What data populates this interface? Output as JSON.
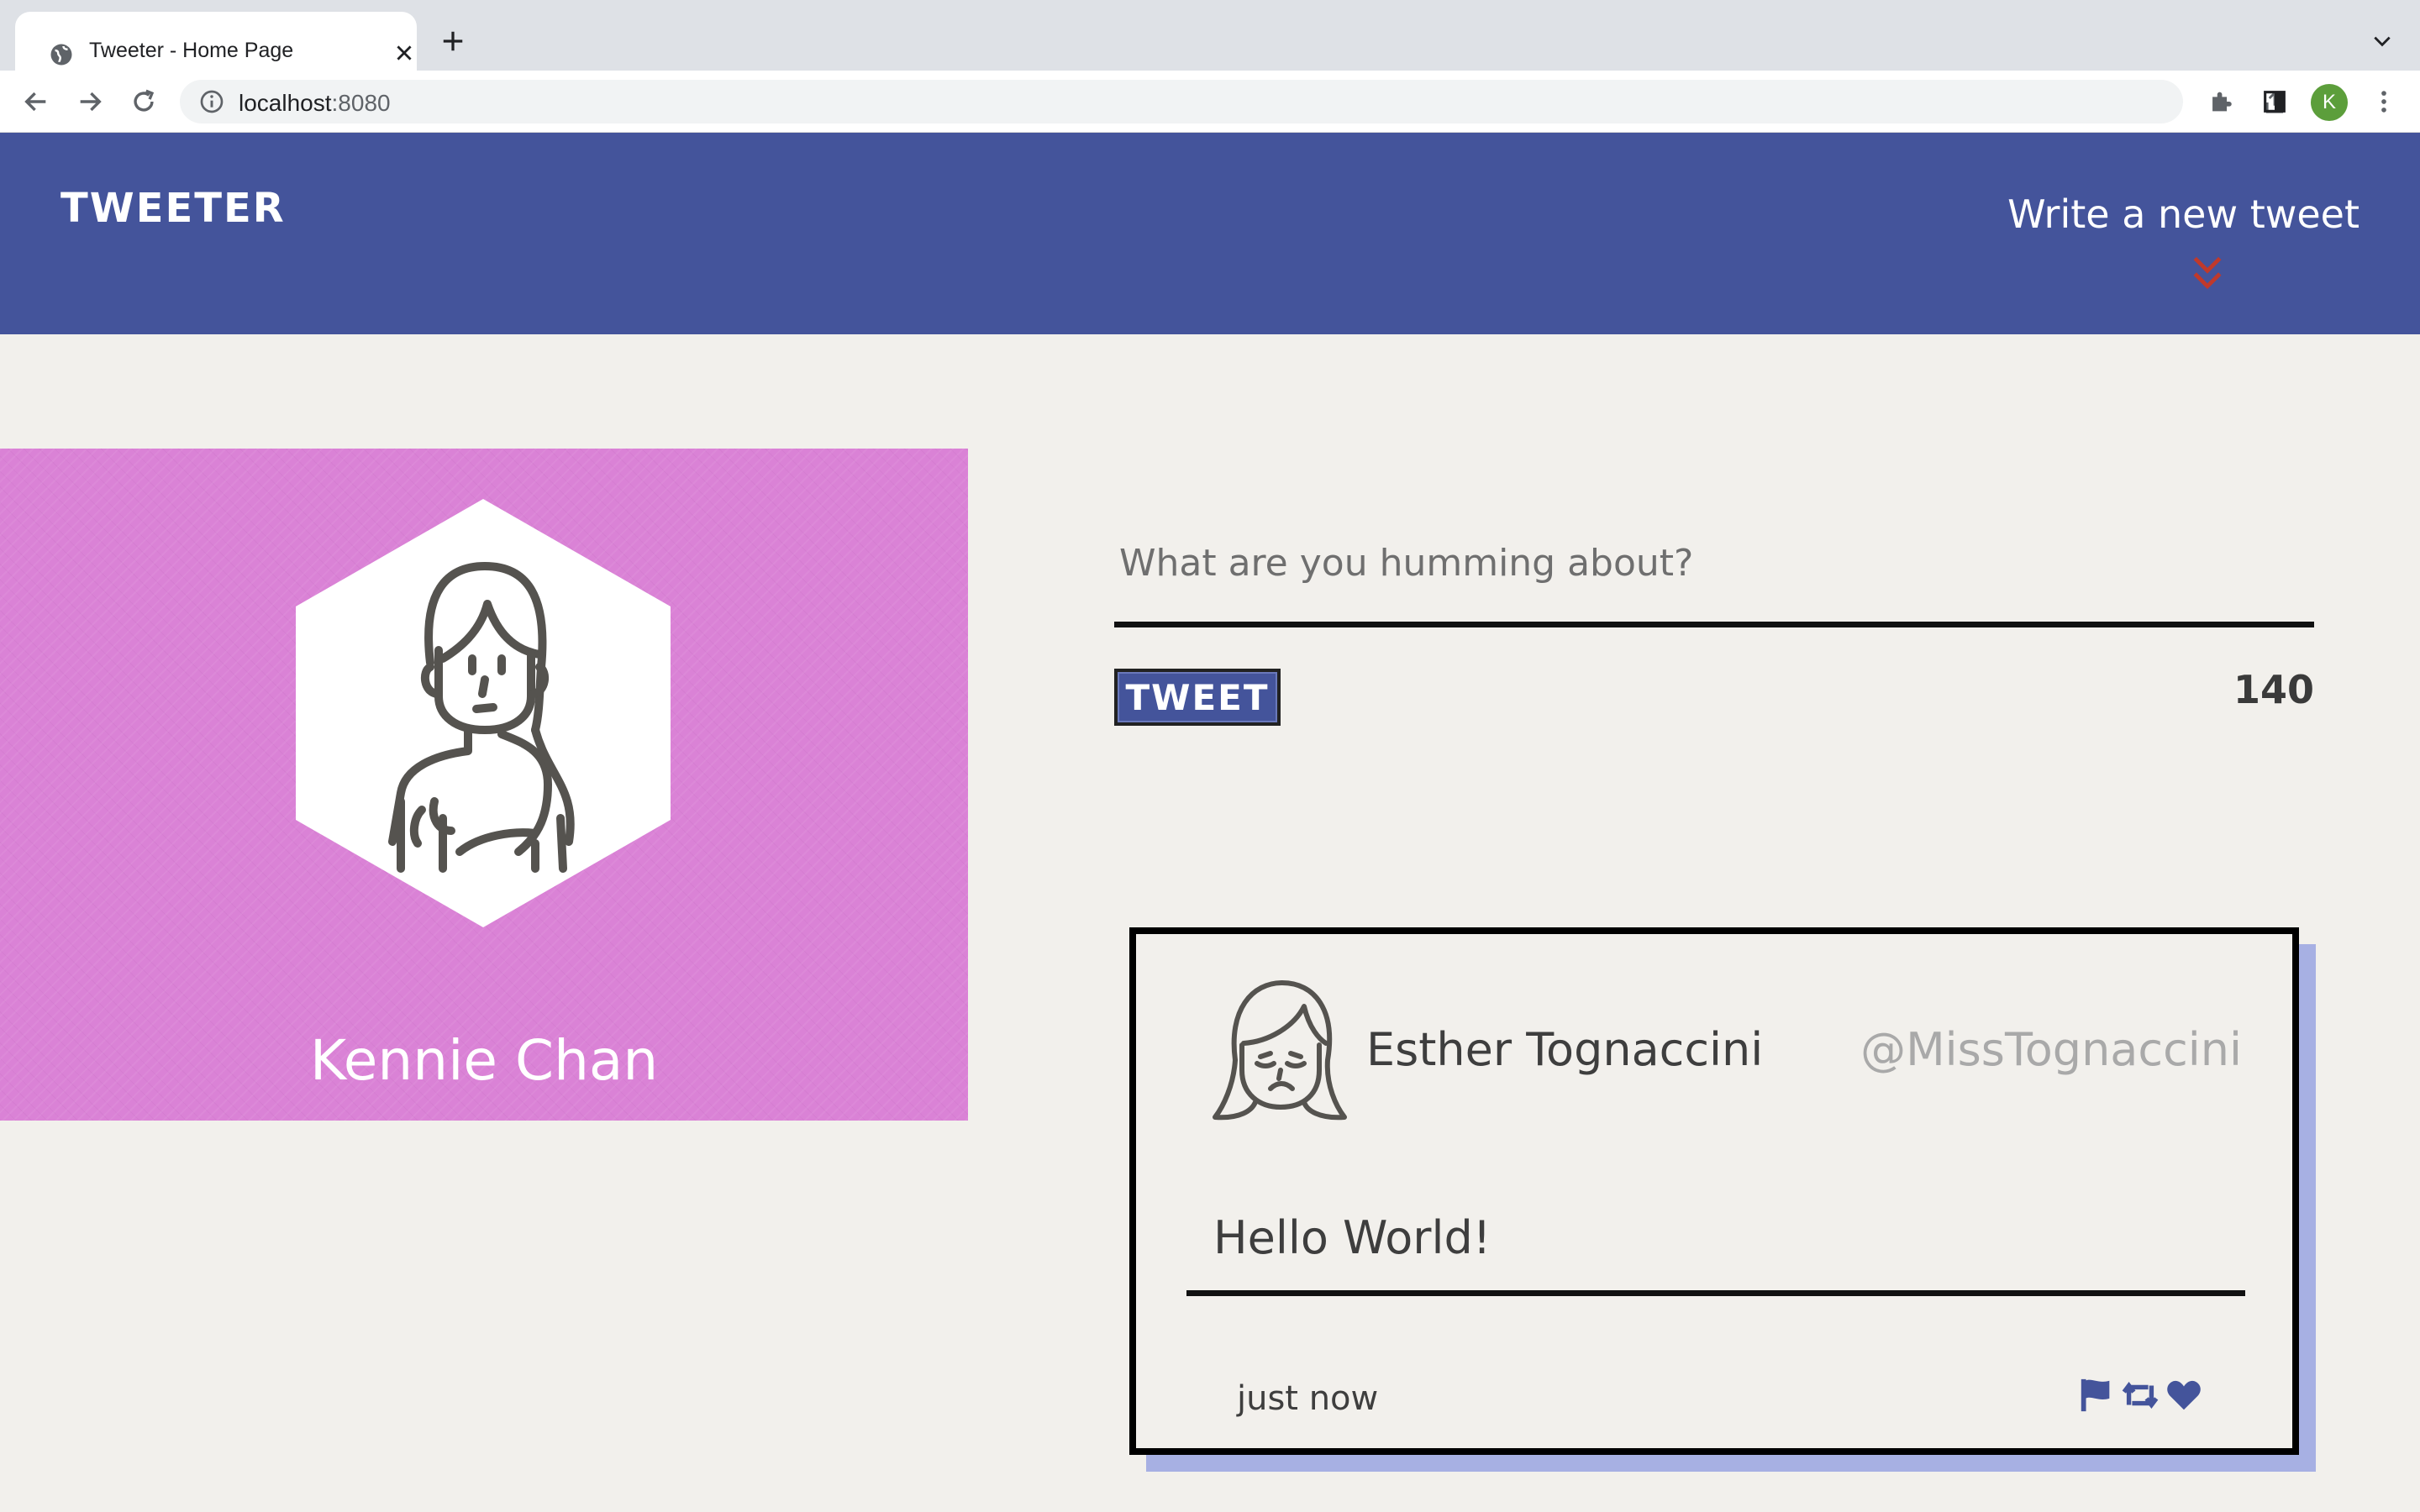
{
  "browser": {
    "tab_title": "Tweeter - Home Page",
    "url_host": "localhost",
    "url_port": ":8080",
    "profile_initial": "K"
  },
  "header": {
    "logo": "TWEETER",
    "compose_link": "Write a new tweet"
  },
  "profile": {
    "name": "Kennie Chan"
  },
  "composer": {
    "placeholder": "What are you humming about?",
    "submit_label": "TWEET",
    "char_count": "140"
  },
  "tweets": [
    {
      "name": "Esther Tognaccini",
      "handle": "@MissTognaccini",
      "text": "Hello World!",
      "time": "just now",
      "actions": [
        "flag-icon",
        "retweet-icon",
        "heart-icon"
      ]
    }
  ],
  "colors": {
    "header_bg": "#44549b",
    "profile_bg": "#da82d6",
    "page_bg": "#f2f0ec",
    "chevron": "#c0392b",
    "tweet_shadow": "#a7b0e3",
    "action_icons": "#44549b"
  }
}
